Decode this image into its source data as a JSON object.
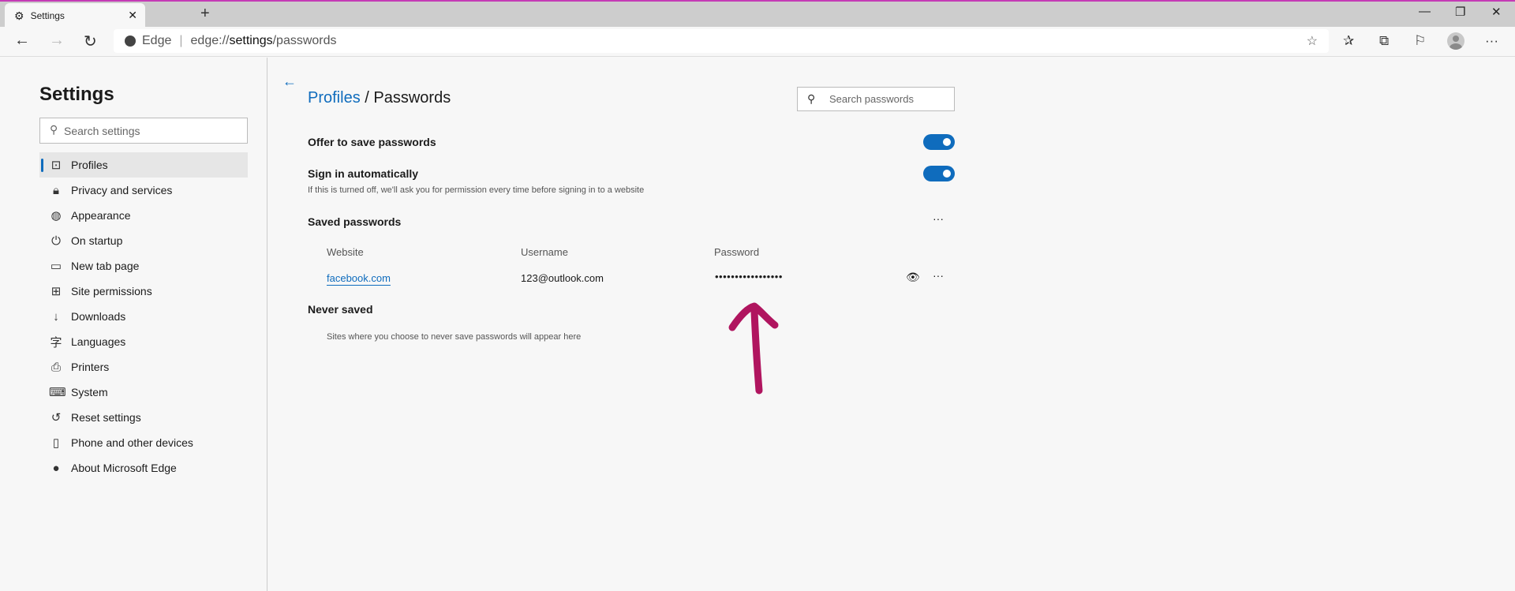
{
  "browser": {
    "tab_title": "Settings",
    "address_prefix": "Edge",
    "address_url_start": "edge://",
    "address_url_bold": "settings",
    "address_url_end": "/passwords"
  },
  "sidebar": {
    "title": "Settings",
    "search_placeholder": "Search settings",
    "items": [
      {
        "label": "Profiles",
        "icon": "profile-icon"
      },
      {
        "label": "Privacy and services",
        "icon": "lock-icon"
      },
      {
        "label": "Appearance",
        "icon": "palette-icon"
      },
      {
        "label": "On startup",
        "icon": "power-icon"
      },
      {
        "label": "New tab page",
        "icon": "new-tab-icon"
      },
      {
        "label": "Site permissions",
        "icon": "site-permissions-icon"
      },
      {
        "label": "Downloads",
        "icon": "download-icon"
      },
      {
        "label": "Languages",
        "icon": "languages-icon"
      },
      {
        "label": "Printers",
        "icon": "printer-icon"
      },
      {
        "label": "System",
        "icon": "laptop-icon"
      },
      {
        "label": "Reset settings",
        "icon": "reset-icon"
      },
      {
        "label": "Phone and other devices",
        "icon": "phone-icon"
      },
      {
        "label": "About Microsoft Edge",
        "icon": "edge-icon"
      }
    ]
  },
  "main": {
    "breadcrumb_parent": "Profiles",
    "breadcrumb_sep": "/",
    "breadcrumb_current": "Passwords",
    "search_placeholder": "Search passwords",
    "offer_label": "Offer to save passwords",
    "offer_on": true,
    "signin_label": "Sign in automatically",
    "signin_on": true,
    "signin_desc": "If this is turned off, we'll ask you for permission every time before signing in to a website",
    "saved_title": "Saved passwords",
    "more": "···",
    "columns": [
      "Website",
      "Username",
      "Password"
    ],
    "rows": [
      {
        "website": "facebook.com",
        "username": "123@outlook.com",
        "password": "•••••••••••••••••"
      }
    ],
    "never_title": "Never saved",
    "never_desc": "Sites where you choose to never save passwords will appear here"
  },
  "colors": {
    "accent": "#0f6cbd",
    "annotation": "#b0155f"
  }
}
